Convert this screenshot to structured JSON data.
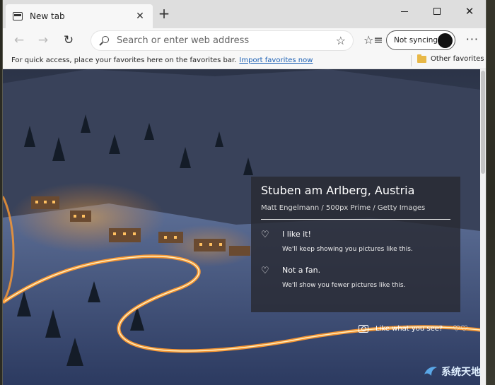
{
  "window": {
    "tab_title": "New tab",
    "new_tab_symbol": "+",
    "tab_close_symbol": "✕",
    "minimize_label": "",
    "close_symbol": "✕"
  },
  "toolbar": {
    "back_symbol": "←",
    "forward_symbol": "→",
    "refresh_symbol": "↻",
    "address_placeholder": "Search or enter web address",
    "star_symbol": "☆",
    "favorites_symbol": "☆≡",
    "sync_label": "Not syncing",
    "more_symbol": "···"
  },
  "favbar": {
    "prompt": "For quick access, place your favorites here on the favorites bar.",
    "import_link": "Import favorites now",
    "other_favorites": "Other favorites"
  },
  "photo": {
    "title": "Stuben am Arlberg, Austria",
    "credit": "Matt Engelmann / 500px Prime / Getty Images",
    "like_label": "I like it!",
    "like_sub": "We'll keep showing you pictures like this.",
    "dislike_label": "Not a fan.",
    "dislike_sub": "We'll show you fewer pictures like this.",
    "prompt": "Like what you see?",
    "heart_symbol": "♡",
    "hearts_symbol": "♡♡"
  },
  "watermark": {
    "text": "系统天地"
  },
  "colors": {
    "link": "#1a5fb4",
    "card_bg": "rgba(40,42,50,0.82)",
    "folder": "#e8b847"
  }
}
